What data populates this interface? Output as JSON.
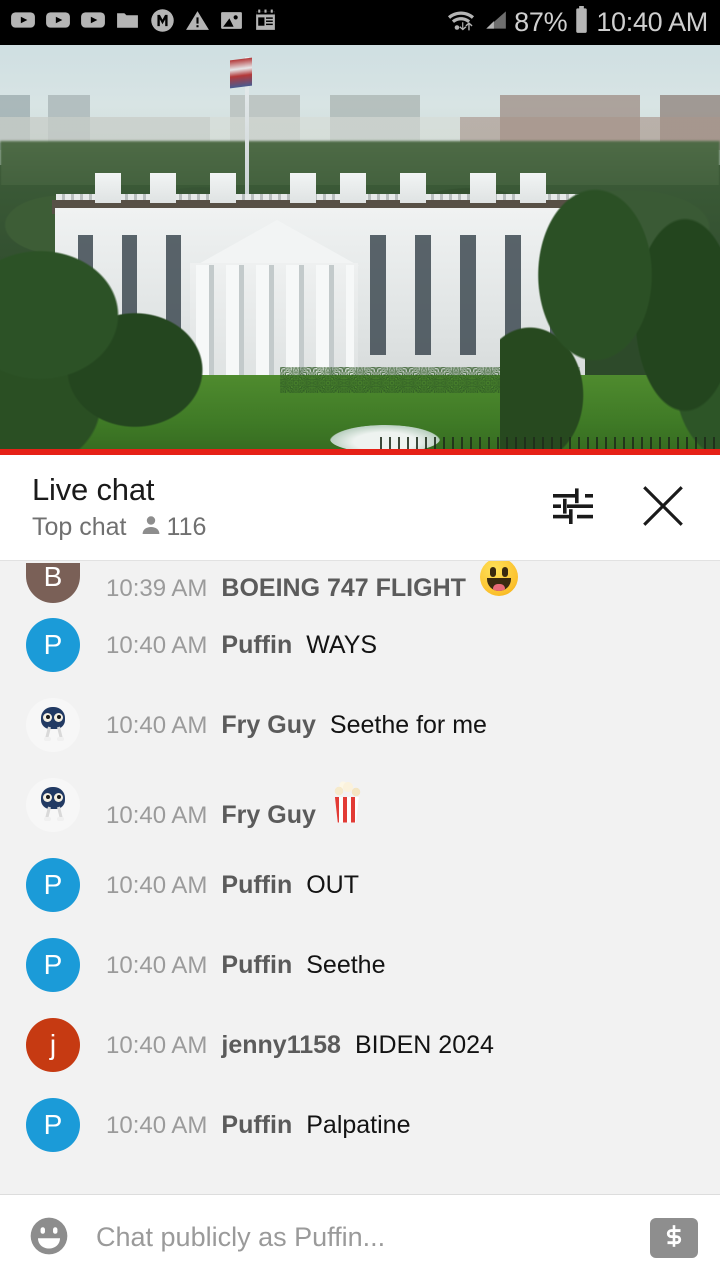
{
  "status_bar": {
    "left_icons": [
      {
        "name": "youtube-icon"
      },
      {
        "name": "youtube-icon"
      },
      {
        "name": "youtube-icon"
      },
      {
        "name": "folder-icon"
      },
      {
        "name": "m-circle-icon"
      },
      {
        "name": "warning-triangle-icon"
      },
      {
        "name": "image-icon"
      },
      {
        "name": "notes-icon"
      }
    ],
    "wifi_icon": "wifi-icon",
    "signal_icon": "cell-signal-icon",
    "battery_percent": "87%",
    "battery_icon": "battery-icon",
    "clock": "10:40 AM"
  },
  "video": {
    "name": "white-house-live-stream",
    "progress_color": "#e62117"
  },
  "chat_header": {
    "title": "Live chat",
    "mode": "Top chat",
    "viewer_icon": "person-icon",
    "viewer_count": "116",
    "settings_label": "chat-settings",
    "close_label": "close-chat"
  },
  "messages": [
    {
      "avatar_type": "letter",
      "avatar_letter": "B",
      "avatar_color": "#7a6057",
      "time": "10:39 AM",
      "author": "BOEING 747 FLIGHT",
      "text": "",
      "emoji": "grinning-face",
      "clipped": true
    },
    {
      "avatar_type": "letter",
      "avatar_letter": "P",
      "avatar_color": "#1b9bd8",
      "time": "10:40 AM",
      "author": "Puffin",
      "text": "WAYS",
      "emoji": "",
      "clipped": false
    },
    {
      "avatar_type": "photo",
      "avatar_letter": "",
      "avatar_color": "#f7f7f7",
      "time": "10:40 AM",
      "author": "Fry Guy",
      "text": "Seethe for me",
      "emoji": "",
      "clipped": false
    },
    {
      "avatar_type": "photo",
      "avatar_letter": "",
      "avatar_color": "#f7f7f7",
      "time": "10:40 AM",
      "author": "Fry Guy",
      "text": "",
      "emoji": "popcorn",
      "clipped": false
    },
    {
      "avatar_type": "letter",
      "avatar_letter": "P",
      "avatar_color": "#1b9bd8",
      "time": "10:40 AM",
      "author": "Puffin",
      "text": "OUT",
      "emoji": "",
      "clipped": false
    },
    {
      "avatar_type": "letter",
      "avatar_letter": "P",
      "avatar_color": "#1b9bd8",
      "time": "10:40 AM",
      "author": "Puffin",
      "text": "Seethe",
      "emoji": "",
      "clipped": false
    },
    {
      "avatar_type": "letter",
      "avatar_letter": "j",
      "avatar_color": "#c63a12",
      "time": "10:40 AM",
      "author": "jenny1158",
      "text": "BIDEN 2024",
      "emoji": "",
      "clipped": false
    },
    {
      "avatar_type": "letter",
      "avatar_letter": "P",
      "avatar_color": "#1b9bd8",
      "time": "10:40 AM",
      "author": "Puffin",
      "text": "Palpatine",
      "emoji": "",
      "clipped": false
    }
  ],
  "input_bar": {
    "emoji_icon": "emoji-smiley-icon",
    "placeholder": "Chat publicly as Puffin...",
    "value": "",
    "superchat_icon": "dollar-icon"
  }
}
